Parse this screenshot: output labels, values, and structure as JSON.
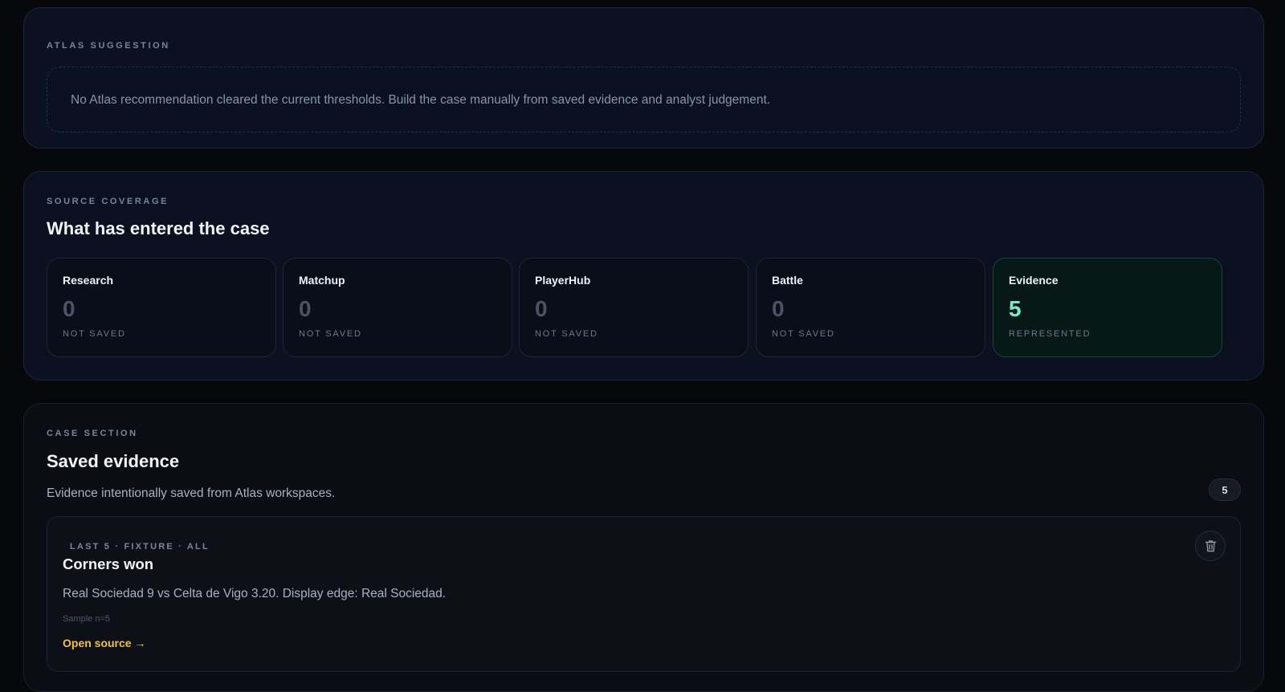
{
  "atlas_suggestion": {
    "eyebrow": "ATLAS SUGGESTION",
    "message": "No Atlas recommendation cleared the current thresholds. Build the case manually from saved evidence and analyst judgement."
  },
  "source_coverage": {
    "eyebrow": "SOURCE COVERAGE",
    "title": "What has entered the case",
    "cards": [
      {
        "name": "Research",
        "count": "0",
        "status": "NOT SAVED"
      },
      {
        "name": "Matchup",
        "count": "0",
        "status": "NOT SAVED"
      },
      {
        "name": "PlayerHub",
        "count": "0",
        "status": "NOT SAVED"
      },
      {
        "name": "Battle",
        "count": "0",
        "status": "NOT SAVED"
      },
      {
        "name": "Evidence",
        "count": "5",
        "status": "REPRESENTED"
      }
    ]
  },
  "case_section": {
    "eyebrow": "CASE SECTION",
    "title": "Saved evidence",
    "description": "Evidence intentionally saved from Atlas workspaces.",
    "count_badge": "5",
    "evidence": [
      {
        "meta": "LAST 5 · FIXTURE · ALL",
        "title": "Corners won",
        "body": "Real Sociedad 9 vs Celta de Vigo 3.20. Display edge: Real Sociedad.",
        "sample": "Sample n=5",
        "link": "Open source →",
        "delete_icon": "trash-icon"
      }
    ]
  },
  "colors": {
    "background": "#06080c",
    "panel": "#0b1120",
    "accent_teal": "#7ee9c8",
    "link_gold": "#f0c14b"
  }
}
